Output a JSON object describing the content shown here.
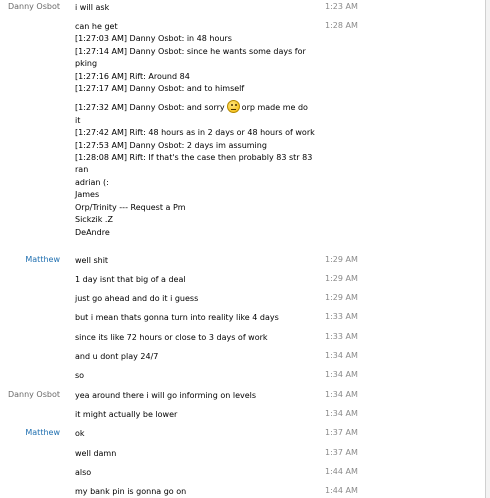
{
  "messages": [
    {
      "sender": "Danny Osbot",
      "color": "gray",
      "time": "1:23 AM",
      "lines": [
        "i will ask"
      ]
    },
    {
      "sender": "",
      "color": "gray",
      "time": "1:28 AM",
      "lines": [
        "can he get",
        "[1:27:03 AM] Danny Osbot: in 48 hours",
        "[1:27:14 AM] Danny Osbot: since he wants some days for",
        "pking",
        "[1:27:16 AM] Rift: Around 84",
        "[1:27:17 AM] Danny Osbot: and to himself",
        "[1:27:32 AM] Danny Osbot: and sorry",
        "it",
        "[1:27:42 AM] Rift: 48 hours as in 2 days or 48 hours of work",
        "[1:27:53 AM] Danny Osbot: 2 days im assuming",
        "[1:28:08 AM] Rift: If that's the case then probably 83 str 83",
        "ran",
        "adrian (:",
        "James",
        "Orp/Trinity --- Request a Pm",
        "Sickzik .Z",
        "DeAndre"
      ],
      "line6_suffix": "orp made me do",
      "emoji": "sad-face-emoji"
    },
    {
      "sender": "Matthew",
      "color": "blue",
      "time": "1:29 AM",
      "lines": [
        "well shit"
      ]
    },
    {
      "sender": "",
      "color": "blue",
      "time": "1:29 AM",
      "lines": [
        "1 day isnt that big of a deal"
      ]
    },
    {
      "sender": "",
      "color": "blue",
      "time": "1:29 AM",
      "lines": [
        "just go ahead and do it i guess"
      ]
    },
    {
      "sender": "",
      "color": "blue",
      "time": "1:33 AM",
      "lines": [
        "but i mean thats gonna turn into reality like 4 days"
      ]
    },
    {
      "sender": "",
      "color": "blue",
      "time": "1:33 AM",
      "lines": [
        "since its like 72 hours or close to 3 days of work"
      ]
    },
    {
      "sender": "",
      "color": "blue",
      "time": "1:34 AM",
      "lines": [
        "and u dont play 24/7"
      ]
    },
    {
      "sender": "",
      "color": "blue",
      "time": "1:34 AM",
      "lines": [
        "so"
      ]
    },
    {
      "sender": "Danny Osbot",
      "color": "gray",
      "time": "1:34 AM",
      "lines": [
        "yea around there i will go informing on levels"
      ]
    },
    {
      "sender": "",
      "color": "gray",
      "time": "1:34 AM",
      "lines": [
        "it might actually be lower"
      ]
    },
    {
      "sender": "Matthew",
      "color": "blue",
      "time": "1:37 AM",
      "lines": [
        "ok"
      ]
    },
    {
      "sender": "",
      "color": "blue",
      "time": "1:37 AM",
      "lines": [
        "well damn"
      ]
    },
    {
      "sender": "",
      "color": "blue",
      "time": "1:44 AM",
      "lines": [
        "also"
      ]
    },
    {
      "sender": "",
      "color": "blue",
      "time": "1:44 AM",
      "lines": [
        "my bank pin is gonna go on"
      ]
    }
  ]
}
